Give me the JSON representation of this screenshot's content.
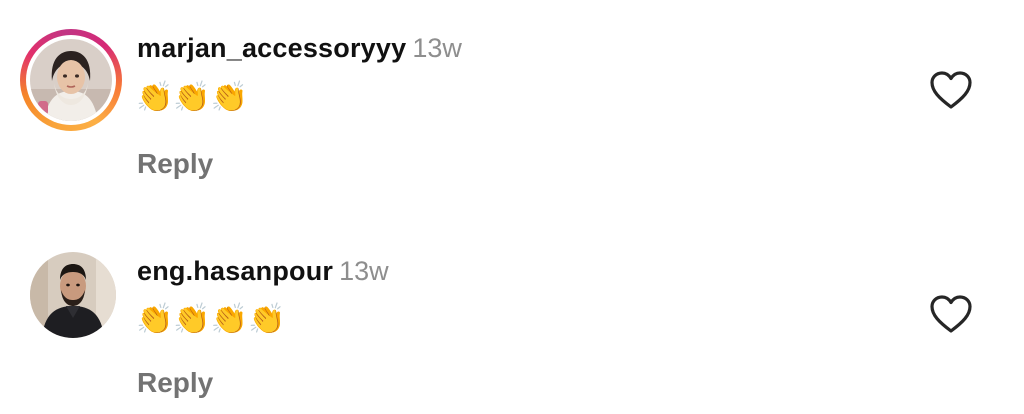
{
  "comments": [
    {
      "username": "marjan_accessoryyy",
      "time": "13w",
      "text": "👏👏👏",
      "reply_label": "Reply",
      "avatar_ring": "story"
    },
    {
      "username": "eng.hasanpour",
      "time": "13w",
      "text": "👏👏👏👏",
      "reply_label": "Reply",
      "avatar_ring": "none"
    }
  ],
  "icons": {
    "like": "heart-outline-icon"
  },
  "colors": {
    "username": "#111111",
    "secondary": "#8e8e8e",
    "reply": "#737373",
    "icon": "#262626"
  }
}
